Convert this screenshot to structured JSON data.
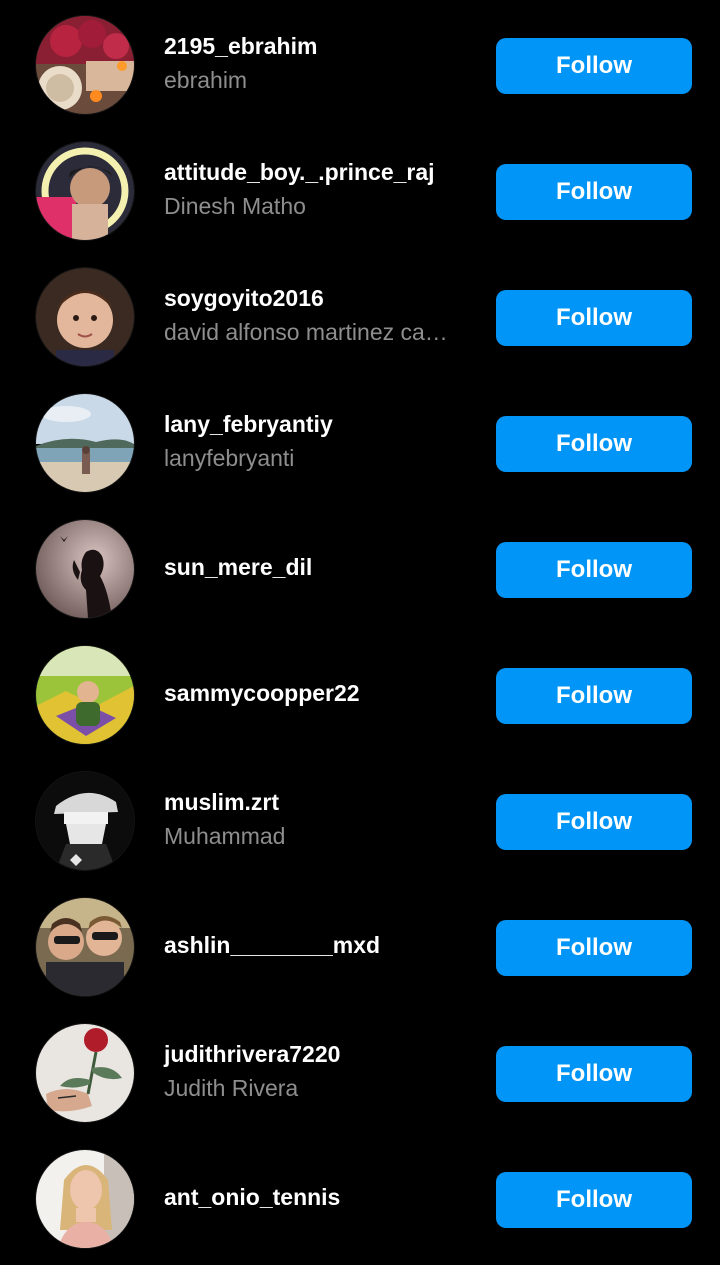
{
  "accounts": [
    {
      "username": "2195_ebrahim",
      "full_name": "ebrahim",
      "button_label": "Follow",
      "avatar_icon": "avatar-roses-photo"
    },
    {
      "username": "attitude_boy._.prince_raj",
      "full_name": "Dinesh Matho",
      "button_label": "Follow",
      "avatar_icon": "avatar-boy-ring-light-photo"
    },
    {
      "username": "soygoyito2016",
      "full_name": "david alfonso martinez ca…",
      "button_label": "Follow",
      "avatar_icon": "avatar-child-portrait-photo"
    },
    {
      "username": "lany_febryantiy",
      "full_name": "lanyfebryanti",
      "button_label": "Follow",
      "avatar_icon": "avatar-beach-photo"
    },
    {
      "username": "sun_mere_dil",
      "full_name": "",
      "button_label": "Follow",
      "avatar_icon": "avatar-silhouette-butterfly-photo"
    },
    {
      "username": "sammycoopper22",
      "full_name": "",
      "button_label": "Follow",
      "avatar_icon": "avatar-toddler-playroom-photo"
    },
    {
      "username": "muslim.zrt",
      "full_name": "Muhammad",
      "button_label": "Follow",
      "avatar_icon": "avatar-masked-cap-drawing"
    },
    {
      "username": "ashlin________mxd",
      "full_name": "",
      "button_label": "Follow",
      "avatar_icon": "avatar-two-women-selfie-photo"
    },
    {
      "username": "judithrivera7220",
      "full_name": "Judith Rivera",
      "button_label": "Follow",
      "avatar_icon": "avatar-rose-hand-photo"
    },
    {
      "username": "ant_onio_tennis",
      "full_name": "",
      "button_label": "Follow",
      "avatar_icon": "avatar-blonde-woman-photo"
    }
  ],
  "colors": {
    "background": "#000000",
    "button": "#0095f6",
    "primary_text": "#ffffff",
    "secondary_text": "#8e8e8e"
  }
}
